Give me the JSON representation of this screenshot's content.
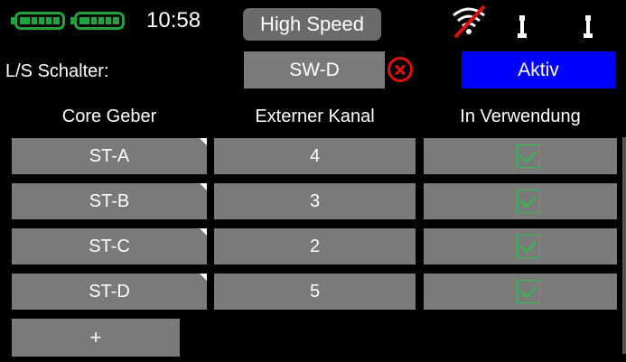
{
  "status": {
    "time": "10:58",
    "mode_label": "High Speed",
    "battery_icons": [
      "battery-icon",
      "battery-icon"
    ],
    "signal_icon": "signal-off-icon",
    "stick_icons": [
      "stick-icon",
      "stick-icon"
    ]
  },
  "switch_row": {
    "label": "L/S Schalter:",
    "switch_value": "SW-D",
    "clear_icon": "close-circle-icon",
    "state_label": "Aktiv"
  },
  "table": {
    "headers": [
      "Core Geber",
      "Externer Kanal",
      "In Verwendung"
    ],
    "rows": [
      {
        "geber": "ST-A",
        "kanal": "4",
        "in_use": true
      },
      {
        "geber": "ST-B",
        "kanal": "3",
        "in_use": true
      },
      {
        "geber": "ST-C",
        "kanal": "2",
        "in_use": true
      },
      {
        "geber": "ST-D",
        "kanal": "5",
        "in_use": true
      }
    ],
    "add_label": "+"
  },
  "colors": {
    "background": "#000000",
    "cell": "#7a7a7a",
    "active": "#0000ff",
    "battery": "#1fa33a",
    "check": "#2ec04a",
    "clear": "#e01010"
  }
}
